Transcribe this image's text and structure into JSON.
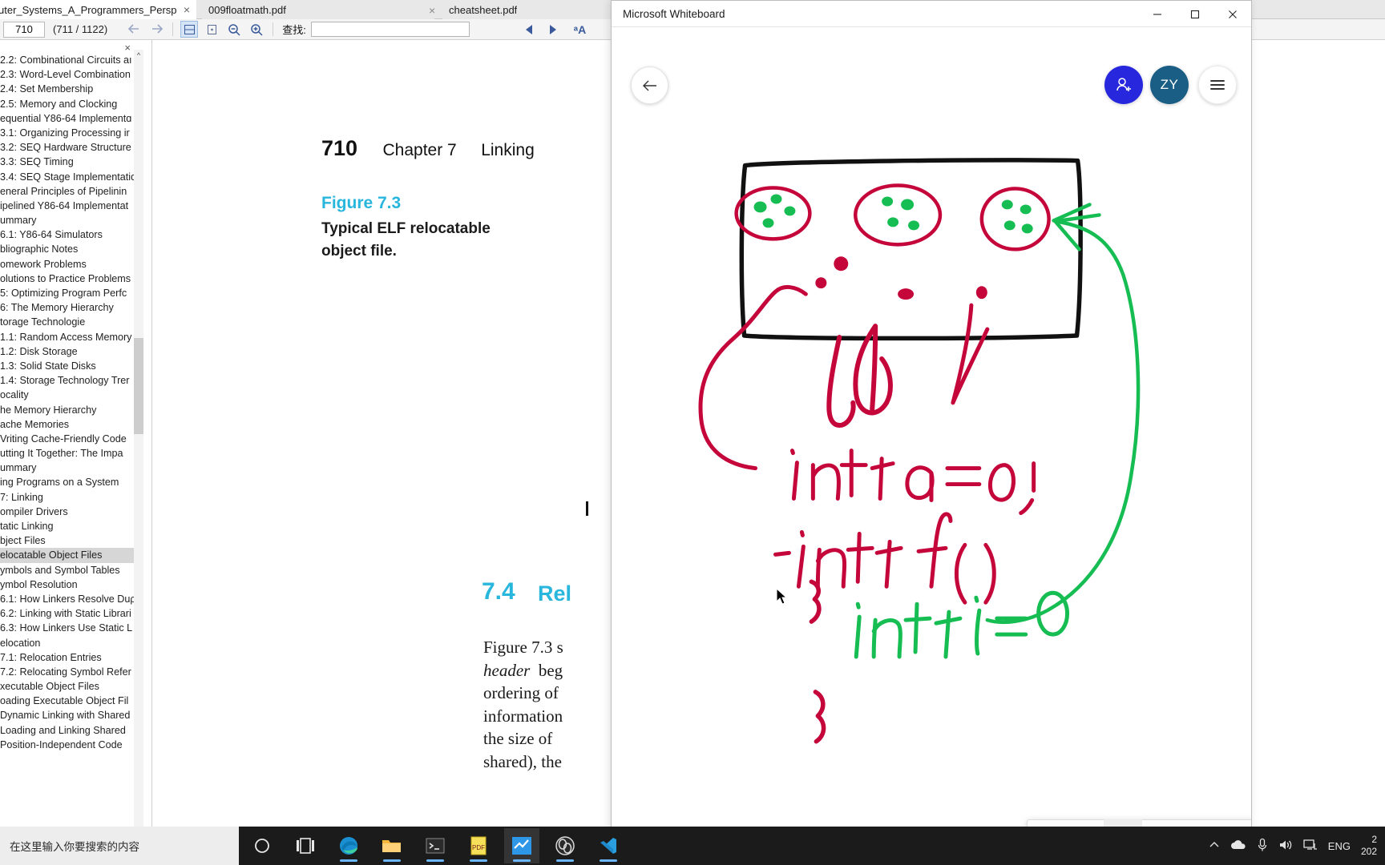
{
  "pdf_reader": {
    "tabs": [
      {
        "label": "uter_Systems_A_Programmers_Perspec...",
        "close": "×",
        "active": true
      },
      {
        "label": "009floatmath.pdf",
        "close": "×",
        "active": false
      },
      {
        "label": "cheatsheet.pdf",
        "close": "",
        "active": false
      }
    ],
    "toolbar": {
      "page_value": "710",
      "page_count": "(711 / 1122)",
      "back_icon": "back-arrow-icon",
      "forward_icon": "forward-arrow-icon",
      "fit_page_icon": "fit-page-icon",
      "fit_width_icon": "fit-width-icon",
      "zoom_out_icon": "zoom-out-icon",
      "zoom_in_icon": "zoom-in-icon",
      "find_label": "查找:",
      "find_value": "",
      "find_placeholder": "",
      "prev_icon": "prev-match-icon",
      "next_icon": "next-match-icon",
      "text_select_icon": "text-select-icon"
    },
    "sidebar": {
      "close_label": "×",
      "scroll_up_icon": "chevron-up-icon",
      "bookmarks": [
        {
          "label": "2.2: Combinational Circuits aı",
          "selected": false
        },
        {
          "label": "2.3: Word-Level Combination",
          "selected": false
        },
        {
          "label": "2.4: Set Membership",
          "selected": false
        },
        {
          "label": "2.5: Memory and Clocking",
          "selected": false
        },
        {
          "label": "equential Y86-64 Implementɑ",
          "selected": false
        },
        {
          "label": "3.1: Organizing Processing ir",
          "selected": false
        },
        {
          "label": "3.2: SEQ Hardware Structure",
          "selected": false
        },
        {
          "label": "3.3: SEQ Timing",
          "selected": false
        },
        {
          "label": "3.4: SEQ Stage Implementatiɑ",
          "selected": false
        },
        {
          "label": "eneral Principles of Pipelinin",
          "selected": false
        },
        {
          "label": "ipelined Y86-64 Implementat",
          "selected": false
        },
        {
          "label": "ummary",
          "selected": false
        },
        {
          "label": "6.1: Y86-64 Simulators",
          "selected": false
        },
        {
          "label": "bliographic Notes",
          "selected": false
        },
        {
          "label": "omework Problems",
          "selected": false
        },
        {
          "label": "olutions to Practice Problems",
          "selected": false
        },
        {
          "label": "5: Optimizing Program Perfc",
          "selected": false
        },
        {
          "label": "6: The Memory Hierarchy",
          "selected": false
        },
        {
          "label": "torage Technologie",
          "selected": false
        },
        {
          "label": "1.1: Random Access Memory",
          "selected": false
        },
        {
          "label": "1.2: Disk Storage",
          "selected": false
        },
        {
          "label": "1.3: Solid State Disks",
          "selected": false
        },
        {
          "label": "1.4: Storage Technology Trer",
          "selected": false
        },
        {
          "label": "ocality",
          "selected": false
        },
        {
          "label": "he Memory Hierarchy",
          "selected": false
        },
        {
          "label": "ache Memories",
          "selected": false
        },
        {
          "label": "Vriting Cache-Friendly Code",
          "selected": false
        },
        {
          "label": "utting It Together: The Impa",
          "selected": false
        },
        {
          "label": "ummary",
          "selected": false
        },
        {
          "label": "ing Programs on a System",
          "selected": false
        },
        {
          "label": "7: Linking",
          "selected": false
        },
        {
          "label": "ompiler Drivers",
          "selected": false
        },
        {
          "label": "tatic Linking",
          "selected": false
        },
        {
          "label": "bject Files",
          "selected": false
        },
        {
          "label": "elocatable Object Files",
          "selected": true
        },
        {
          "label": "ymbols and Symbol Tables",
          "selected": false
        },
        {
          "label": "ymbol Resolution",
          "selected": false
        },
        {
          "label": "6.1: How Linkers Resolve Duρ",
          "selected": false
        },
        {
          "label": "6.2: Linking with Static Librari",
          "selected": false
        },
        {
          "label": "6.3: How Linkers Use Static L",
          "selected": false
        },
        {
          "label": "elocation",
          "selected": false
        },
        {
          "label": "7.1: Relocation Entries",
          "selected": false
        },
        {
          "label": "7.2: Relocating Symbol Refer",
          "selected": false
        },
        {
          "label": "xecutable Object Files",
          "selected": false
        },
        {
          "label": "oading Executable Object Fil",
          "selected": false
        },
        {
          "label": "Dynamic Linking with Shared",
          "selected": false
        },
        {
          "label": "Loading and Linking Shared",
          "selected": false
        },
        {
          "label": "Position-Independent Code",
          "selected": false
        }
      ]
    },
    "page": {
      "page_number": "710",
      "chapter": "Chapter 7",
      "chapter_title": "Linking",
      "figure_label": "Figure 7.3",
      "figure_caption": "Typical ELF relocatable object file.",
      "section_number": "7.4",
      "section_title": "Rel",
      "body_lines": [
        "Figure 7.3 s",
        "header  beg",
        "ordering of",
        "information",
        "the size of",
        "shared), the"
      ],
      "heading_color": "#29b6dd"
    }
  },
  "whiteboard": {
    "window_title": "Microsoft Whiteboard",
    "window_controls": {
      "minimize": "─",
      "maximize": "☐",
      "close": "✕"
    },
    "back_icon": "back-arrow-icon",
    "invite_icon": "add-person-icon",
    "avatar_initials": "ZY",
    "menu_icon": "hamburger-menu-icon",
    "colors": {
      "invite_blue": "#2727dd",
      "avatar_teal": "#1a5e85",
      "ink_red": "#c4063a",
      "ink_green": "#16bd52",
      "ink_black": "#111111"
    },
    "toolbar": {
      "tools": [
        {
          "name": "check-tool",
          "type": "check",
          "selected": false
        },
        {
          "name": "pen-black",
          "type": "pen",
          "color": "#111111",
          "selected": false
        },
        {
          "name": "pen-red",
          "type": "pen",
          "color": "#d01c3a",
          "selected": true
        },
        {
          "name": "pen-blue",
          "type": "pen",
          "color": "#1678c8",
          "selected": false
        },
        {
          "name": "pen-green",
          "type": "pen",
          "color": "#18a04a",
          "selected": false
        },
        {
          "name": "pen-rainbow",
          "type": "pen",
          "color": "rainbow",
          "selected": false
        },
        {
          "name": "pen-galaxy",
          "type": "pen",
          "color": "galaxy",
          "selected": false
        },
        {
          "name": "highlighter-yellow",
          "type": "highlighter",
          "color": "#f5ec7a",
          "selected": false
        },
        {
          "name": "eraser",
          "type": "eraser",
          "color": "#f0a0c8",
          "selected": false
        },
        {
          "name": "ruler",
          "type": "ruler",
          "selected": false
        },
        {
          "name": "lasso-select",
          "type": "lasso",
          "selected": false
        },
        {
          "name": "undo",
          "type": "undo",
          "selected": false
        },
        {
          "name": "redo",
          "type": "redo",
          "selected": false
        }
      ]
    },
    "ink_text": {
      "ld": "ld",
      "decl_a": "int a=0;",
      "decl_f": "int f()",
      "brace_open": "{",
      "decl_i": "int i = 0",
      "brace_close": "}"
    }
  },
  "taskbar": {
    "search_placeholder": "在这里输入你要搜索的内容",
    "items": [
      {
        "name": "cortana-icon",
        "running": false
      },
      {
        "name": "task-view-icon",
        "running": false
      },
      {
        "name": "edge-icon",
        "running": true
      },
      {
        "name": "file-explorer-icon",
        "running": true
      },
      {
        "name": "terminal-icon",
        "running": true
      },
      {
        "name": "pdf-reader-icon",
        "running": true
      },
      {
        "name": "whiteboard-icon",
        "running": true,
        "active": true
      },
      {
        "name": "obs-icon",
        "running": true
      },
      {
        "name": "vscode-icon",
        "running": true
      }
    ],
    "tray": {
      "overflow_icon": "chevron-up-icon",
      "onedrive_icon": "cloud-icon",
      "mic_icon": "microphone-icon",
      "volume_icon": "speaker-icon",
      "network_icon": "network-display-icon",
      "language": "ENG",
      "clock_time": "2",
      "clock_date": "202"
    }
  }
}
